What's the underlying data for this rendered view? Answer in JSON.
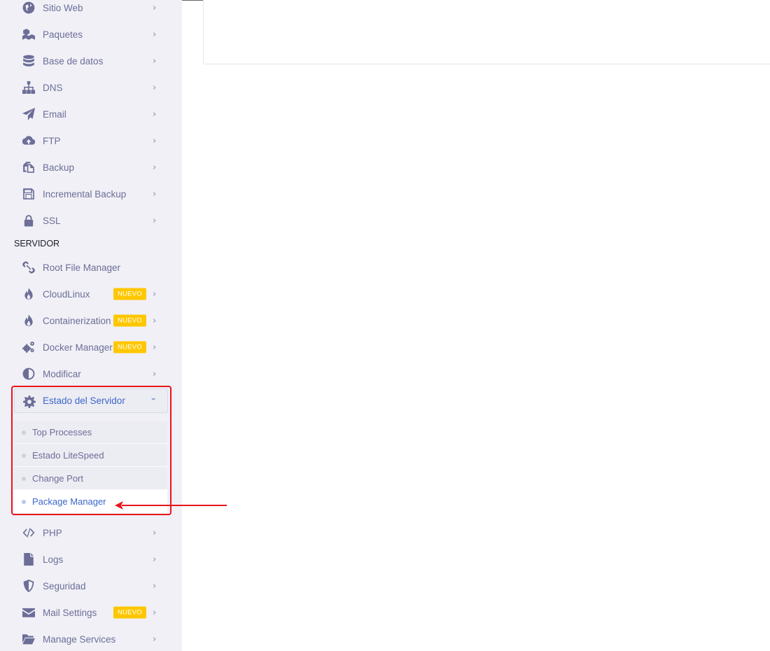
{
  "sidebar": {
    "items_top": [
      {
        "label": "Sitio Web",
        "icon": "globe-icon"
      },
      {
        "label": "Paquetes",
        "icon": "cubes-icon"
      },
      {
        "label": "Base de datos",
        "icon": "database-icon"
      },
      {
        "label": "DNS",
        "icon": "sitemap-icon"
      },
      {
        "label": "Email",
        "icon": "paper-plane-icon"
      },
      {
        "label": "FTP",
        "icon": "cloud-upload-icon"
      },
      {
        "label": "Backup",
        "icon": "copy-icon"
      },
      {
        "label": "Incremental Backup",
        "icon": "floppy-icon"
      },
      {
        "label": "SSL",
        "icon": "lock-icon"
      }
    ],
    "section_title": "SERVIDOR",
    "items_server": [
      {
        "label": "Root File Manager",
        "icon": "link-icon"
      },
      {
        "label": "CloudLinux",
        "icon": "fire-icon",
        "badge": "NUEVO"
      },
      {
        "label": "Containerization",
        "icon": "fire-icon",
        "badge": "NUEVO"
      },
      {
        "label": "Docker Manager",
        "icon": "cogs-icon",
        "badge": "NUEVO"
      },
      {
        "label": "Modificar",
        "icon": "adjust-icon"
      }
    ],
    "expanded": {
      "label": "Estado del Servidor",
      "icon": "gear-icon",
      "chevron": "›",
      "subitems": [
        {
          "label": "Top Processes",
          "active": false
        },
        {
          "label": "Estado LiteSpeed",
          "active": false
        },
        {
          "label": "Change Port",
          "active": false
        },
        {
          "label": "Package Manager",
          "active": true
        }
      ]
    },
    "items_bottom": [
      {
        "label": "PHP",
        "icon": "code-icon"
      },
      {
        "label": "Logs",
        "icon": "file-icon"
      },
      {
        "label": "Seguridad",
        "icon": "shield-icon"
      },
      {
        "label": "Mail Settings",
        "icon": "envelope-icon",
        "badge": "NUEVO"
      },
      {
        "label": "Manage Services",
        "icon": "folder-open-icon"
      }
    ],
    "chevron": "›"
  },
  "colors": {
    "sidebar_bg": "#f0f0f6",
    "menu_text": "#6c6e98",
    "active_text": "#3a67c9",
    "badge_bg": "#ffc700",
    "highlight_red": "#e8151b"
  }
}
